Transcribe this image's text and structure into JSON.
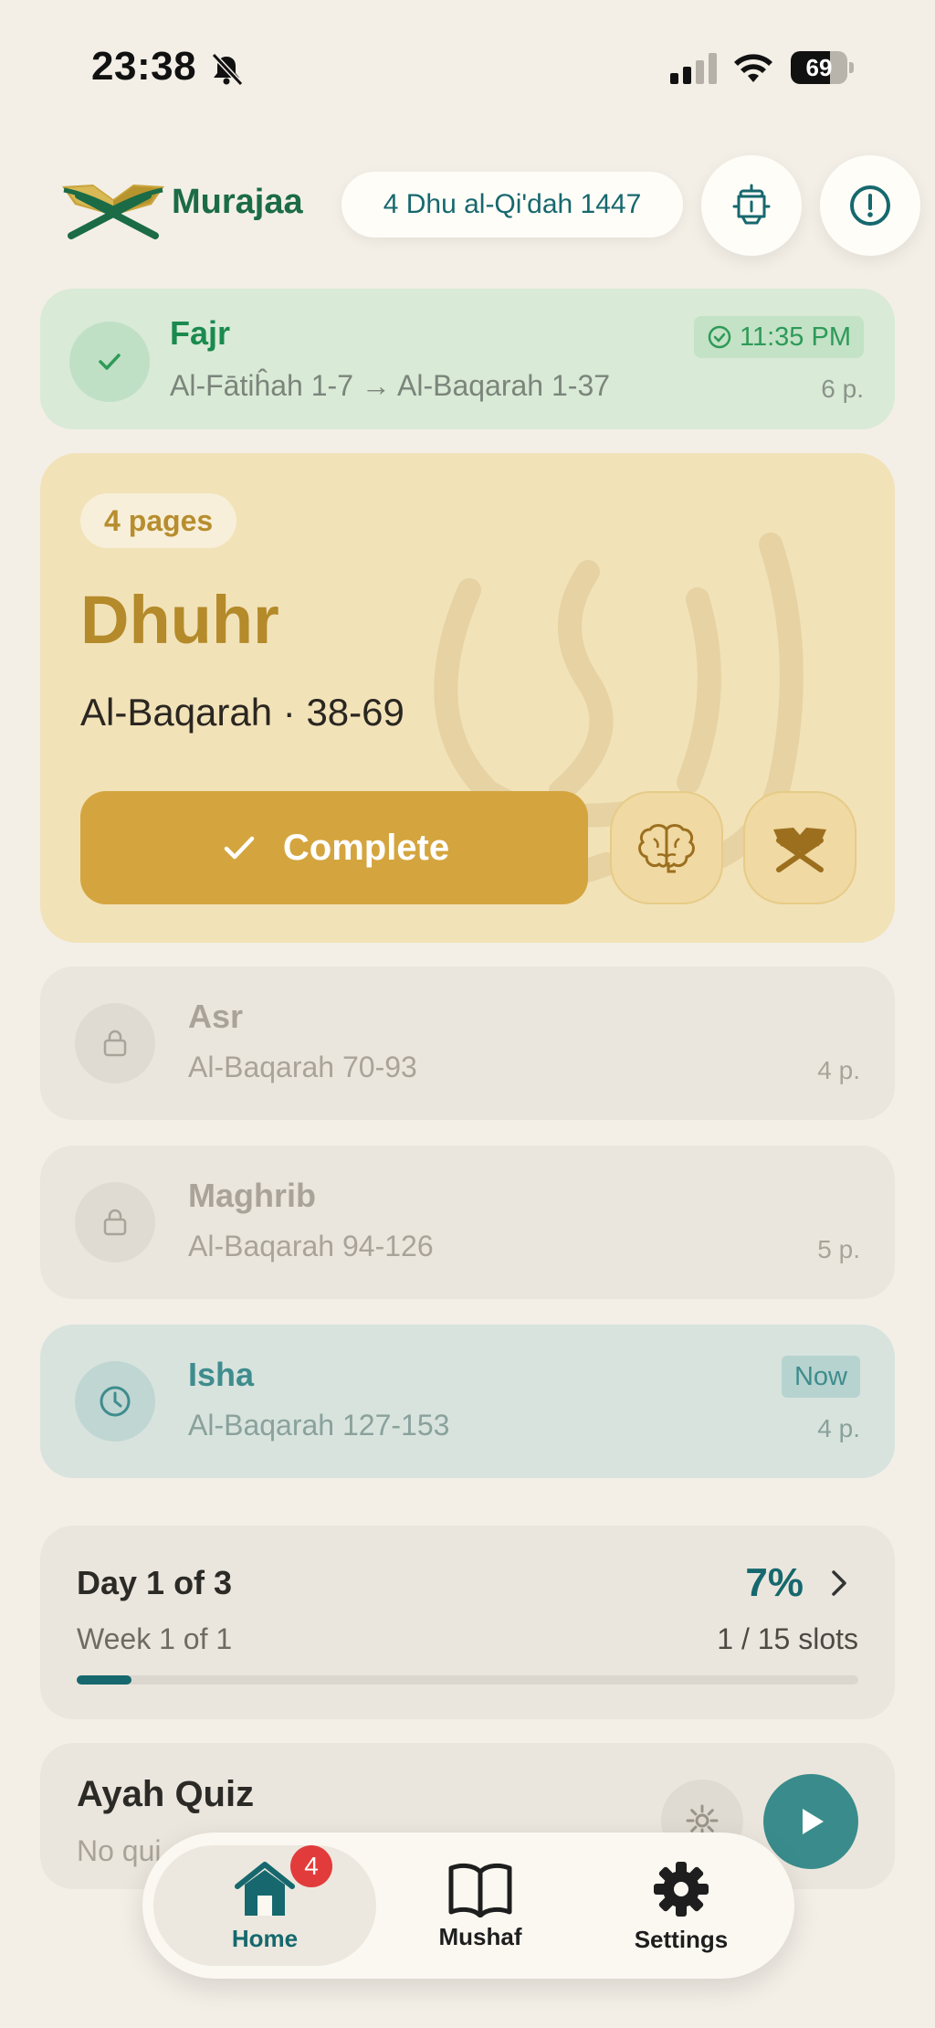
{
  "status_bar": {
    "time": "23:38",
    "battery": "69",
    "battery_level": 0.69
  },
  "header": {
    "app_name": "Murajaa",
    "hijri_date": "4 Dhu al-Qi'dah 1447",
    "icons": [
      "lantern-icon",
      "alert-icon"
    ]
  },
  "prayers": {
    "fajr": {
      "name": "Fajr",
      "range": "Al-Fātiĥah 1-7 → Al-Baqarah 1-37",
      "completed_time": "11:35 PM",
      "pages": "6 p.",
      "state": "done"
    },
    "dhuhr": {
      "badge": "4 pages",
      "name": "Dhuhr",
      "range": "Al-Baqarah · 38-69",
      "complete_label": "Complete",
      "state": "active"
    },
    "asr": {
      "name": "Asr",
      "range": "Al-Baqarah 70-93",
      "pages": "4 p.",
      "state": "locked"
    },
    "maghrib": {
      "name": "Maghrib",
      "range": "Al-Baqarah 94-126",
      "pages": "5 p.",
      "state": "locked"
    },
    "isha": {
      "name": "Isha",
      "range": "Al-Baqarah 127-153",
      "pages": "4 p.",
      "badge": "Now",
      "state": "now"
    }
  },
  "progress": {
    "day": "Day 1 of 3",
    "week": "Week 1 of 1",
    "percent_label": "7%",
    "slots": "1 / 15 slots",
    "fraction": 0.07
  },
  "quiz": {
    "title": "Ayah Quiz",
    "subtitle": "No qui"
  },
  "nav": {
    "home": "Home",
    "home_badge": "4",
    "mushaf": "Mushaf",
    "settings": "Settings"
  },
  "colors": {
    "accent_teal": "#16686e",
    "gold": "#d4a53f",
    "green": "#1b8a4e"
  }
}
